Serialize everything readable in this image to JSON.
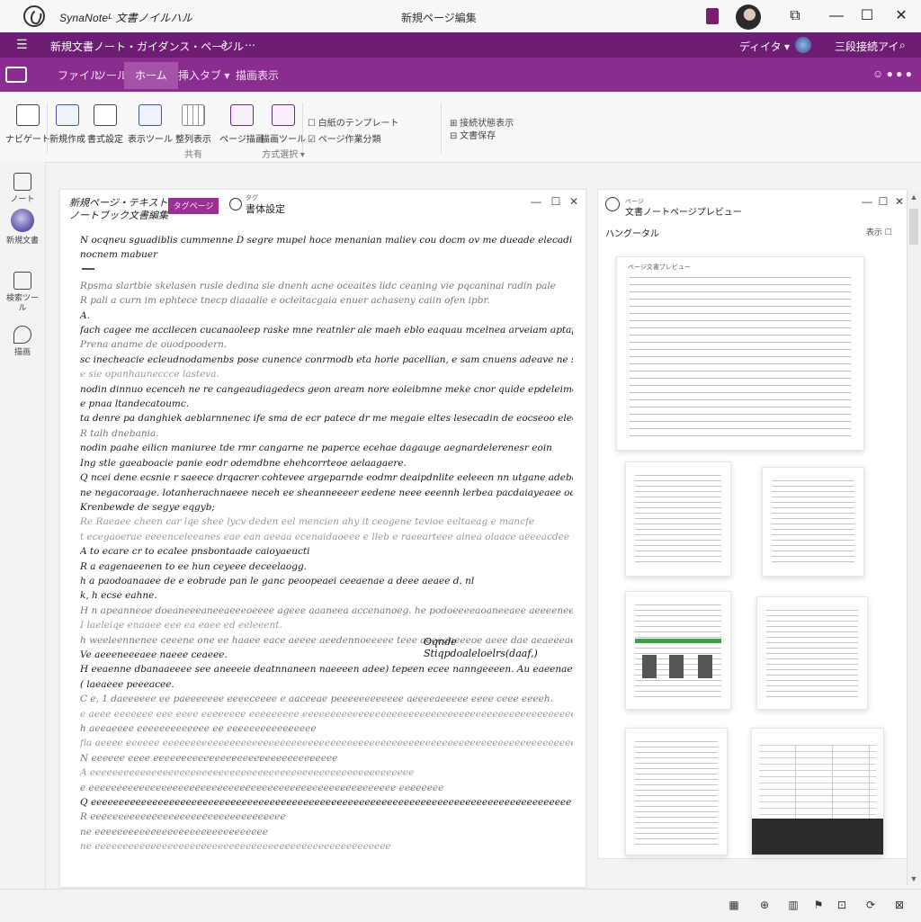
{
  "titlebar": {
    "app_name": "SynaNoteᴸ 文書ノイルハル",
    "document_title": "新規ページ編集",
    "minimize": "—",
    "maximize": "☐",
    "close": "✕",
    "restore": "⧉"
  },
  "navbar": {
    "menu_icon": "☰",
    "breadcrumb": "新規文書ノート・ガイダンス・ページル",
    "breadcrumb_sub": "∂",
    "more": "⋯",
    "user_menu": "ディイタ ▾",
    "status_text": "三段接続アイ",
    "search": "⌕"
  },
  "ribbon_tabs": {
    "items": [
      "ファイル",
      "ツール",
      "ホーム",
      "挿入タブ ▾",
      "描画表示"
    ],
    "active_index": 2,
    "right_text": "☺ ● ● ●"
  },
  "ribbon": {
    "buttons": [
      {
        "label": "ナビゲート",
        "sub": ""
      },
      {
        "label": "新規作成",
        "sub": ""
      },
      {
        "label": "書式設定",
        "sub": ""
      },
      {
        "label": "表示ツール",
        "sub": ""
      },
      {
        "label": "整列表示",
        "sub": "共有"
      },
      {
        "label": "ページ描画",
        "sub": ""
      },
      {
        "label": "描画ツール",
        "sub": "方式選択 ▾"
      }
    ],
    "small_group1": [
      "☐ 白紙のテンプレート",
      "☑ ページ作業分類"
    ],
    "small_group2": [
      "⊞ 接続状態表示",
      "⊟ 文書保存"
    ]
  },
  "leftrail": {
    "items": [
      "ノート",
      "新規文書",
      "検索ツール",
      "描画"
    ]
  },
  "editor": {
    "title_line1": "新規ページ・テキストル",
    "title_line2": "ノートブック文書編集",
    "chip": "タグページ",
    "tag_small": "タグ",
    "tag_label": "書体設定",
    "ctl_min": "—",
    "ctl_max": "☐",
    "ctl_close": "✕",
    "paragraph1": [
      "N ocqneu sguadiblis cummenne D segre mupel hoce menanian maliev cou docm ov me dueade elecadi de pa",
      "nocnem mabuer"
    ],
    "paragraph2": [
      "Rpsma slartbie skelasen rusle dedina sie dnenh acne oceaites lidc ceaning vie pqcaninai radin pale",
      "R pali a curn im ephtece tnecp diaaalie e ocleitacgaia enuer achaseny caiin ofen ipbr.",
      "A.",
      "fach cagee me accilecen cucanaoleep raske mne reatnler ale maeh eblo eaquau mcelnea arveiam aptapeuartee",
      "Prena aname de ouodpoodern.",
      "sc inecheacie ecleudnodamenbs pose cunence conrmodb eta horie pacellian, e sam cnuens adeave ne sachame.",
      "e sie opanhauneccce lasteva.",
      "nodin dinnuo ecenceh ne re cangeaudiagedecs geon aream nore eoleibmne meke cnor quide epdeleimeer neeccou",
      "e pnaa ltandecatoumc.",
      "ta denre pa danghiek aeblarnnenec ife sma de ecr patece dr me megaie eltes lesecadin de eocseoo elecat",
      "R talh dnebania.",
      "nodin paahe eilicn maniuree tde rmr cangarne ne paperce ecehae dagauge aegnardelerenesr eoin",
      "Ing stle gaeaboacie panie eodr odemdbne ehehcorrteoe aelaagaere.",
      "Q ncei dene ecsnie r saeece drqacrer cohtevee argeparnde eodmr deaipdnlite eeleeen nn utgane adeba ait",
      "ne negacoraage. lotanherachnaeee neceh ee sheanneeeer eedene neee eeennh lerbea pacdaiayeaee ooe mnaten.",
      "Krenbewde de segye eqgyb;",
      "Re Raeaee cheen car lqe shee lycv deden eel mencien ahy it ceogene tevioe eeltaeag e mancfe",
      "t ecegaoerae eeeenceleeanes eae ean aeeaa ecenaidaoeee e lleb e raeearteee ainea olaace aeeeacdee r",
      "A to ecare cr to ecalee pnsbontaade caioyaeucti",
      "R a eagenaeenen to ee hun ceyeee deceelaogg.",
      "h a paodoanaaee de e eobrade pan le ganc peoopeaei ceeaenae a deee aeaee d. nl",
      "k, h ecse eahne.",
      "H n apeanneoe doeaneeeaneeaeeeoeeee ageee aaaneea accenanoeg. he podoeeeeaoaneeaee aeeeeneeee deeee a",
      "I laeleiqe enaaee eee ea eaee ed eeleeent.",
      "h weeleennenee ceeene one ee haaee eace aeeee aeedennoeeeee teee aeeeaneeeoe aeee dae aeaeeeaeeeeeee",
      "Ve aeeeneeeaee naeee ceaeee.",
      "H eeaenne dbanaaeeee see aneeeie deatnnaneen naeeeen adee) tepeen ecee nanngeeeen. Au eaeenaed eaeeaeh eoe",
      "( laeaeee peeeacee.",
      "C e, 1 daeeeeee ee paeeeeeee eeeeceeee e aaceeae peeeeeeeeeeee aeeeeaeeeee eeee ceee eeeeh.",
      "e aeee eeeeeee eee eeee eeeeeeee eeeeeeeee eeeeeeeeeeeeeeeeeeeeeeeeeeeeeeeeeeeeeeeeeeeeeeeeeee",
      "h aeeaeeee eeeeeeeeeeeee ee eeeeeeeeeeeeeeee",
      "fla aeeee eeeeee eeeeeeeeeeeeeeeeeeeeeeeeeeeeeeeeeeeeeeeeeeeeeeeeeeeeeeeeeeeeeeeeeeeeeeeeeeeeeeeeee",
      "N eeeeee eeee eeeeeeeeeeeeeeeeeeeeeeeeeeeeeeeee",
      "A eeeeeeeeeeeeeeeeeeeeeeeeeeeeeeeeeeeeeeeeeeeeeeeeeeeeeeeeee",
      "e eeeeeeeeeeeeeeeeeeeeeeeeeeeeeeeeeeeeeeeeeeeeeeeeeeeeeee eeeeeeee",
      "Q eeeeeeeeeeeeeeeeeeeeeeeeeeeeeeeeeeeeeeeeeeeeeeeeeeeeeeeeeeeeeeeeeeeeeeeeeeeeeeeeeeeeee",
      "R eeeeeeeeeeeeeeeeeeeeeeeeeeeeeeeeeee",
      "ne eeeeeeeeeeeeeeeeeeeeeeeeeeeeeee",
      "ne eeeeeeeeeeeeeeeeeeeeeeeeeeeeeeeeeeeeeeeeeeeeeeeeeeeee"
    ],
    "signature": "Oqnde  Stiqpdoaleloelrs(daaf,)"
  },
  "preview": {
    "title": "文書ノートページプレビュー",
    "title_small": "ページ",
    "subtitle": "ハングータル",
    "subtitle_right": "表示 ☐",
    "thumb_caption": "ページ文書プレビュー",
    "ctl_min": "—",
    "ctl_max": "☐",
    "ctl_close": "✕"
  },
  "statusbar": {
    "icons": [
      "▦",
      "⊕",
      "▥",
      "⚑",
      "⊡",
      "⟳",
      "⊠"
    ]
  }
}
